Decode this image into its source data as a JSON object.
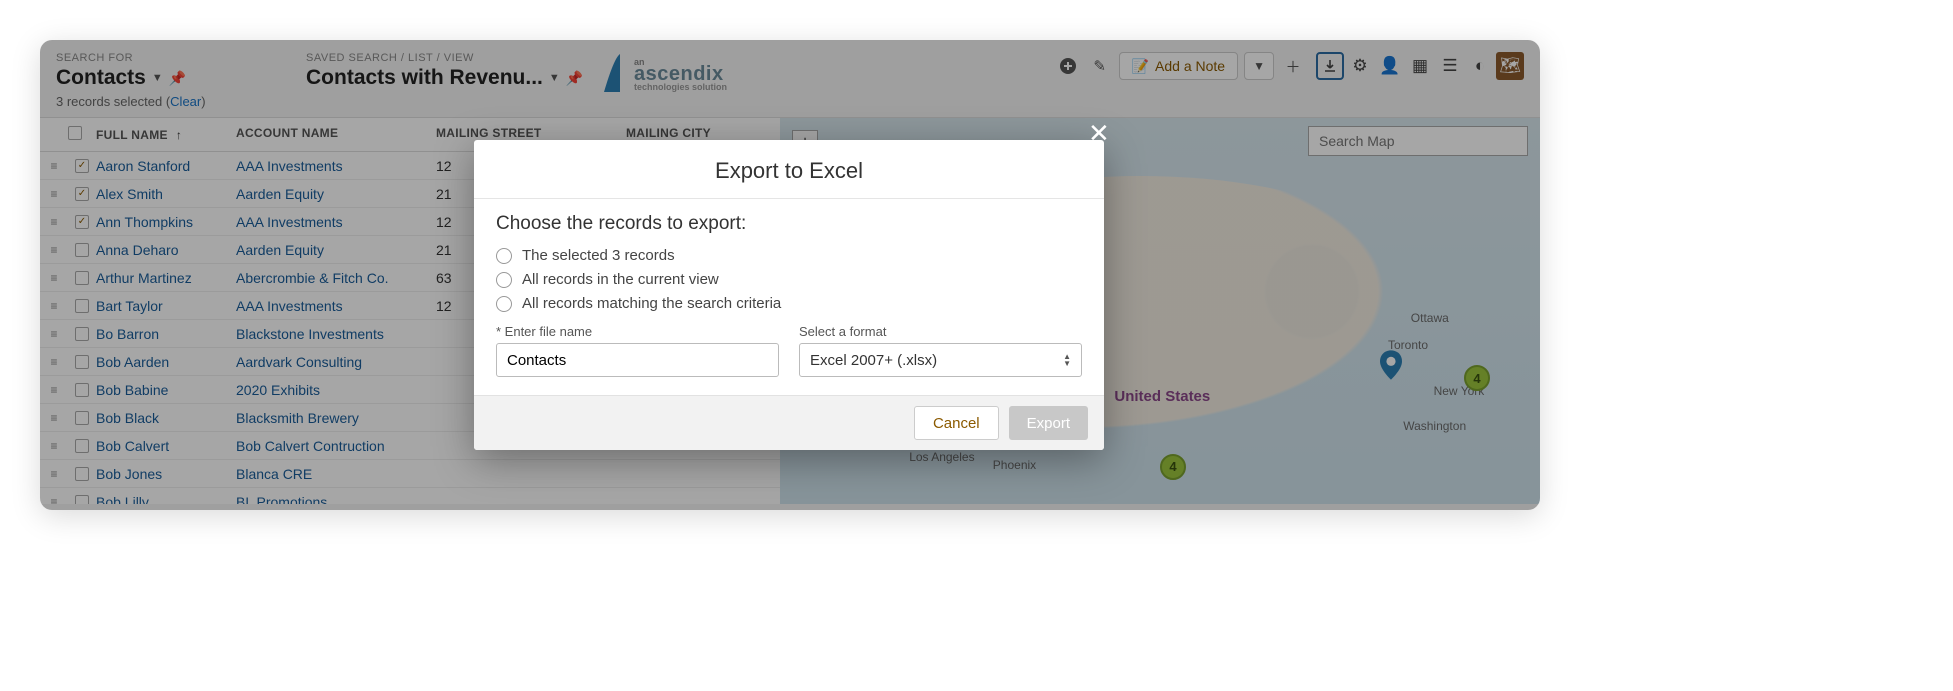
{
  "header": {
    "search_for_label": "SEARCH FOR",
    "search_title": "Contacts",
    "saved_search_breadcrumb": "SAVED SEARCH / LIST / VIEW",
    "saved_search_title": "Contacts with Revenu...",
    "records_selected_prefix": "3 records selected (",
    "records_selected_clear": "Clear",
    "records_selected_suffix": ")",
    "logo_main": "ascendix",
    "logo_prefix": "an",
    "logo_sub": "technologies solution",
    "add_note_label": "Add a Note"
  },
  "columns": {
    "full_name": "FULL NAME",
    "account_name": "ACCOUNT NAME",
    "mailing_street": "MAILING STREET",
    "mailing_city": "MAILING CITY"
  },
  "rows": [
    {
      "checked": true,
      "name": "Aaron Stanford",
      "account": "AAA Investments",
      "street": "12"
    },
    {
      "checked": true,
      "name": "Alex Smith",
      "account": "Aarden Equity",
      "street": "21"
    },
    {
      "checked": true,
      "name": "Ann Thompkins",
      "account": "AAA Investments",
      "street": "12"
    },
    {
      "checked": false,
      "name": "Anna Deharo",
      "account": "Aarden Equity",
      "street": "21"
    },
    {
      "checked": false,
      "name": "Arthur Martinez",
      "account": "Abercrombie & Fitch Co.",
      "street": "63"
    },
    {
      "checked": false,
      "name": "Bart Taylor",
      "account": "AAA Investments",
      "street": "12"
    },
    {
      "checked": false,
      "name": "Bo Barron",
      "account": "Blackstone Investments",
      "street": ""
    },
    {
      "checked": false,
      "name": "Bob Aarden",
      "account": "Aardvark Consulting",
      "street": ""
    },
    {
      "checked": false,
      "name": "Bob Babine",
      "account": "2020 Exhibits",
      "street": ""
    },
    {
      "checked": false,
      "name": "Bob Black",
      "account": "Blacksmith Brewery",
      "street": ""
    },
    {
      "checked": false,
      "name": "Bob Calvert",
      "account": "Bob Calvert Contruction",
      "street": ""
    },
    {
      "checked": false,
      "name": "Bob Jones",
      "account": "Blanca CRE",
      "street": ""
    },
    {
      "checked": false,
      "name": "Bob Lilly",
      "account": "BL Promotions",
      "street": ""
    }
  ],
  "map": {
    "search_placeholder": "Search Map",
    "labels": {
      "united_states": "United States",
      "los_angeles": "Los Angeles",
      "phoenix": "Phoenix",
      "ottawa": "Ottawa",
      "toronto": "Toronto",
      "new_york": "New York",
      "washington": "Washington"
    },
    "badges": {
      "a": "4",
      "b": "4"
    }
  },
  "modal": {
    "title": "Export to Excel",
    "subtitle": "Choose the records to export:",
    "option_selected": "The selected 3 records",
    "option_view": "All records in the current view",
    "option_criteria": "All records matching the search criteria",
    "filename_label": "* Enter file name",
    "filename_value": "Contacts",
    "format_label": "Select a format",
    "format_value": "Excel 2007+ (.xlsx)",
    "cancel": "Cancel",
    "export": "Export"
  }
}
